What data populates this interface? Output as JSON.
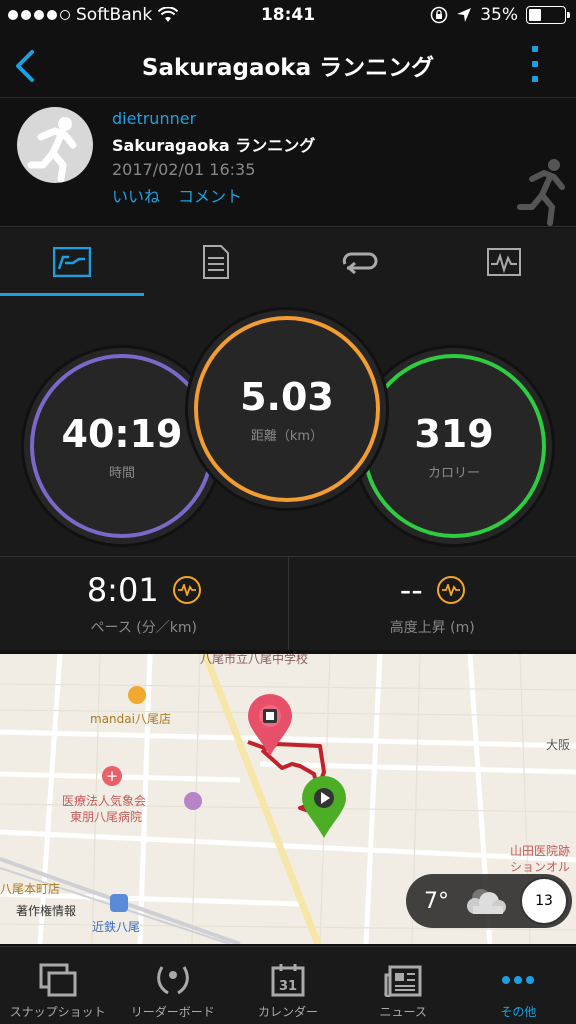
{
  "status": {
    "carrier": "SoftBank",
    "time": "18:41",
    "battery": "35%",
    "battery_level": 0.35
  },
  "nav": {
    "title": "Sakuragaoka ランニング"
  },
  "activity": {
    "user": "dietrunner",
    "name": "Sakuragaoka ランニング",
    "datetime": "2017/02/01 16:35",
    "like_label": "いいね",
    "comment_label": "コメント"
  },
  "stats": {
    "time_value": "40:19",
    "time_label": "時間",
    "distance_value": "5.03",
    "distance_label": "距離（km）",
    "calories_value": "319",
    "calories_label": "カロリー"
  },
  "sub_stats": {
    "pace_value": "8:01",
    "pace_label": "ペース (分／km)",
    "elevation_value": "--",
    "elevation_label": "高度上昇 (m)"
  },
  "map": {
    "labels": {
      "school": "八尾市立八尾中学校",
      "mandai": "mandai八尾店",
      "hospital1": "医療法人気象会",
      "hospital2": "東朋八尾病院",
      "osaka": "大阪",
      "yamada1": "山田医院跡",
      "yamada2": "ションオル",
      "yaohonmachi": "八尾本町店",
      "copyright": "著作権情報",
      "kintetsu": "近鉄八尾"
    }
  },
  "weather": {
    "temperature": "7°",
    "wind": "13"
  },
  "bottom_tabs": [
    {
      "label": "スナップショット"
    },
    {
      "label": "リーダーボード"
    },
    {
      "label": "カレンダー"
    },
    {
      "label": "ニュース"
    },
    {
      "label": "その他"
    }
  ],
  "calendar_day": "31",
  "colors": {
    "accent": "#1ba1e2",
    "time_ring": "#7b68c9",
    "distance_ring": "#f39c2f",
    "calories_ring": "#2ecc40",
    "route": "#c0232c",
    "end_pin": "#e8506a",
    "start_pin": "#4cae24"
  }
}
